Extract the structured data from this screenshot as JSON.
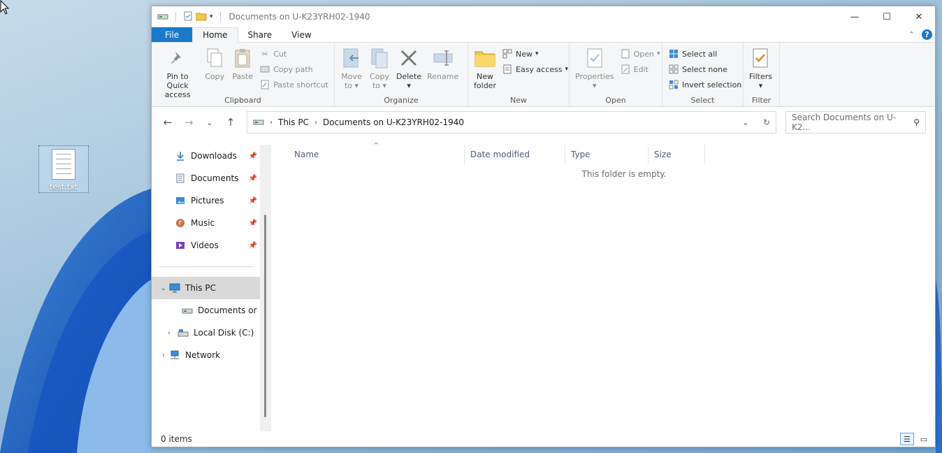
{
  "desktop": {
    "icon_label": "test.txt"
  },
  "window": {
    "title": "Documents on U-K23YRH02-1940",
    "controls": {
      "minimize": "—",
      "maximize": "☐",
      "close": "✕"
    }
  },
  "tabs": [
    {
      "label": "File"
    },
    {
      "label": "Home"
    },
    {
      "label": "Share"
    },
    {
      "label": "View"
    }
  ],
  "ribbon": {
    "clipboard": {
      "name": "Clipboard",
      "pin_line1": "Pin to Quick",
      "pin_line2": "access",
      "copy": "Copy",
      "paste": "Paste",
      "cut": "Cut",
      "copy_path": "Copy path",
      "paste_shortcut": "Paste shortcut"
    },
    "organize": {
      "name": "Organize",
      "move_line1": "Move",
      "move_line2": "to",
      "copy_line1": "Copy",
      "copy_line2": "to",
      "delete": "Delete",
      "rename": "Rename"
    },
    "new": {
      "name": "New",
      "folder_line1": "New",
      "folder_line2": "folder",
      "new_item": "New",
      "easy_access": "Easy access"
    },
    "open": {
      "name": "Open",
      "properties": "Properties",
      "open": "Open",
      "edit": "Edit"
    },
    "select": {
      "name": "Select",
      "select_all": "Select all",
      "select_none": "Select none",
      "invert": "Invert selection"
    },
    "filter": {
      "name": "Filter",
      "filters": "Filters"
    }
  },
  "address": {
    "crumbs": [
      "This PC",
      "Documents on U-K23YRH02-1940"
    ]
  },
  "search": {
    "placeholder": "Search Documents on U-K2..."
  },
  "nav": {
    "quick": [
      {
        "label": "Downloads"
      },
      {
        "label": "Documents"
      },
      {
        "label": "Pictures"
      },
      {
        "label": "Music"
      },
      {
        "label": "Videos"
      }
    ],
    "this_pc": "This PC",
    "documents_on": "Documents or",
    "local_disk": "Local Disk (C:)",
    "network": "Network"
  },
  "columns": [
    {
      "label": "Name"
    },
    {
      "label": "Date modified"
    },
    {
      "label": "Type"
    },
    {
      "label": "Size"
    }
  ],
  "content": {
    "empty_message": "This folder is empty."
  },
  "status": {
    "items": "0 items"
  },
  "colors": {
    "accent": "#1979ca",
    "selected": "#d9d9d9"
  }
}
